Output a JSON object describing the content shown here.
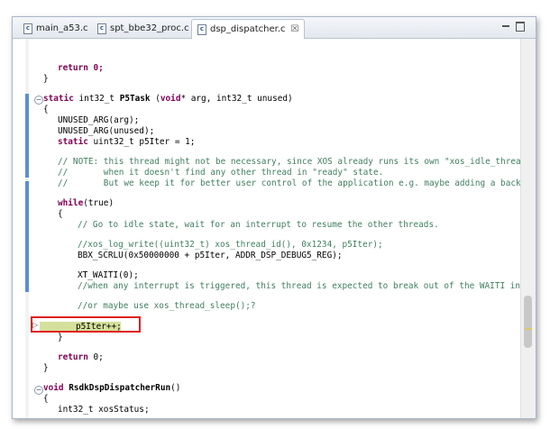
{
  "tabs": [
    {
      "label": "main_a53.c",
      "icon": "c-file-icon"
    },
    {
      "label": "spt_bbe32_proc.c",
      "icon": "c-file-icon"
    },
    {
      "label": "dsp_dispatcher.c",
      "icon": "c-file-icon",
      "close": "☒"
    }
  ],
  "code": {
    "l01": "return 0;",
    "l02": "}",
    "l03a": "static",
    "l03b": "int32_t",
    "l03c": "P5Task",
    "l03d": "(",
    "l03e": "void",
    "l03f": "* arg, int32_t unused)",
    "l04": "{",
    "l05": "UNUSED_ARG(arg);",
    "l06": "UNUSED_ARG(unused);",
    "l07a": "static",
    "l07b": "uint32_t p5Iter = 1;",
    "l08": "// NOTE: this thread might not be necessary, since XOS already runs its own \"xos_idle_thread\"",
    "l09": "//       when it doesn't find any other thread in \"ready\" state.",
    "l10": "//       But we keep it for better user control of the application e.g. maybe adding a backgr",
    "l11a": "while",
    "l11b": "(true)",
    "l12": "{",
    "l13": "// Go to idle state, wait for an interrupt to resume the other threads.",
    "l14": "//xos_log_write((uint32_t) xos_thread_id(), 0x1234, p5Iter);",
    "l15": "BBX_SCRLU(0x50000000 + p5Iter, ADDR_DSP_DEBUG5_REG);",
    "l16": "XT_WAITI(0);",
    "l17": "//when any interrupt is triggered, this thread is expected to break out of the WAITI inst",
    "l18": "//or maybe use xos_thread_sleep();?",
    "l19": "p5Iter++;",
    "l20": "}",
    "l21a": "return",
    "l21b": "0;",
    "l22": "}",
    "l23a": "void",
    "l23b": "RsdkDspDispatcherRun",
    "l23c": "()",
    "l24": "{",
    "l25": "int32_t xosStatus;"
  },
  "window": {
    "minimize": "",
    "maximize": ""
  },
  "colors": {
    "keyword": "#7f0055",
    "comment": "#3f7f5f",
    "highlight": "#d4e09b",
    "box": "#e02020",
    "ruler": "#5b8fd0"
  }
}
